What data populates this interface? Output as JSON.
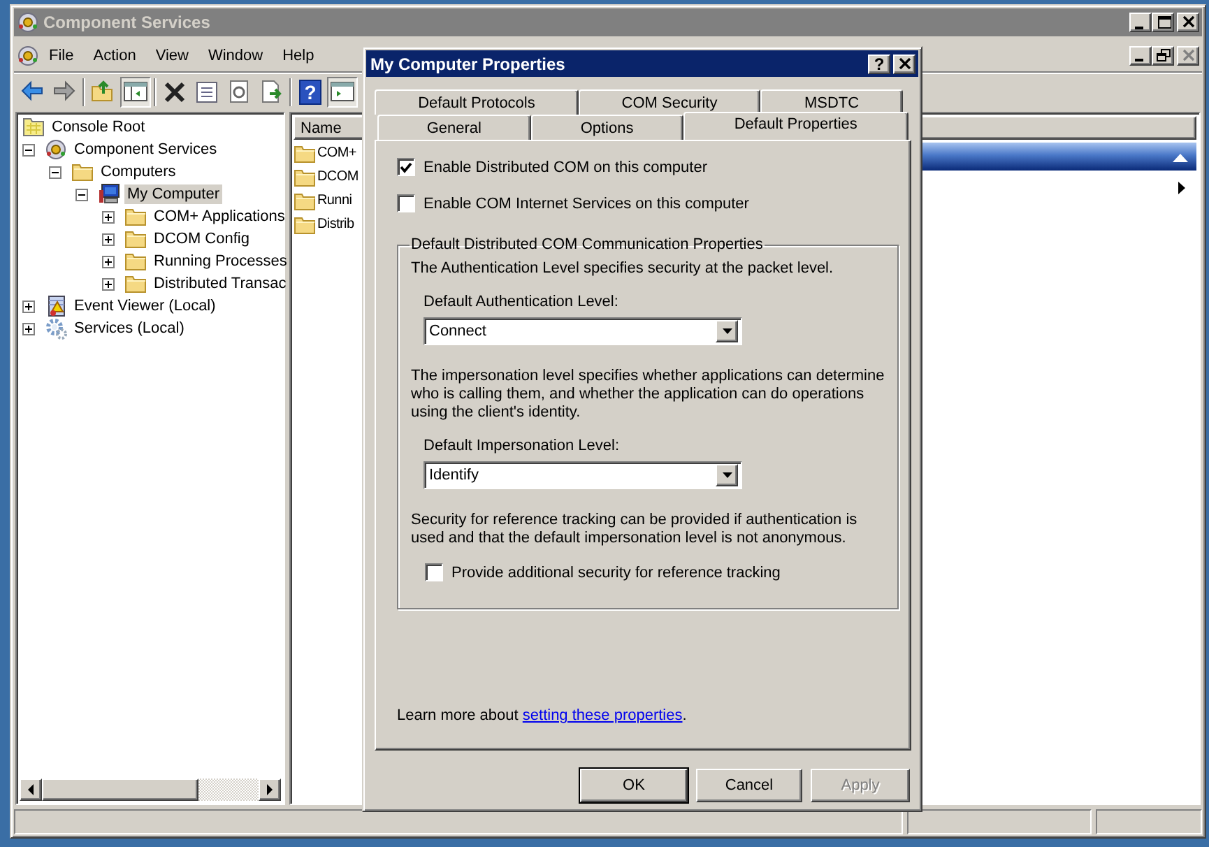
{
  "window": {
    "title": "Component Services"
  },
  "menu": [
    "File",
    "Action",
    "View",
    "Window",
    "Help"
  ],
  "toolbar": {
    "help_glyph": "?"
  },
  "tree": {
    "root": {
      "label": "Console Root",
      "kind": "root",
      "selected": false,
      "children": [
        {
          "label": "Component Services",
          "kind": "component",
          "expanded": true,
          "selected": false,
          "children": [
            {
              "label": "Computers",
              "kind": "folder",
              "expanded": true,
              "selected": false,
              "children": [
                {
                  "label": "My Computer",
                  "kind": "computer",
                  "expanded": true,
                  "selected": true,
                  "children": [
                    {
                      "label": "COM+ Applications",
                      "kind": "folder",
                      "expanded": false,
                      "selected": false
                    },
                    {
                      "label": "DCOM Config",
                      "kind": "folder",
                      "expanded": false,
                      "selected": false
                    },
                    {
                      "label": "Running Processes",
                      "kind": "folder",
                      "expanded": false,
                      "selected": false
                    },
                    {
                      "label": "Distributed Transac",
                      "kind": "folder",
                      "expanded": false,
                      "selected": false
                    }
                  ]
                }
              ]
            }
          ]
        },
        {
          "label": "Event Viewer (Local)",
          "kind": "log",
          "expanded": false,
          "selected": false
        },
        {
          "label": "Services (Local)",
          "kind": "gear",
          "expanded": false,
          "selected": false
        }
      ]
    }
  },
  "list": {
    "column": "Name",
    "items": [
      "COM+",
      "DCOM",
      "Runni",
      "Distrib"
    ]
  },
  "dialog": {
    "title": "My Computer Properties",
    "help_glyph": "?",
    "tab_rows": [
      [
        {
          "label": "Default Protocols",
          "selected": false
        },
        {
          "label": "COM Security",
          "selected": false
        },
        {
          "label": "MSDTC",
          "selected": false
        }
      ],
      [
        {
          "label": "General",
          "selected": false
        },
        {
          "label": "Options",
          "selected": false
        },
        {
          "label": "Default Properties",
          "selected": true
        }
      ]
    ],
    "options": [
      {
        "label": "Enable Distributed COM on this computer",
        "checked": true
      },
      {
        "label": "Enable COM Internet Services on this computer",
        "checked": false
      }
    ],
    "group": {
      "title": "Default Distributed COM Communication Properties",
      "items": [
        {
          "kind": "text",
          "text": "The Authentication Level specifies security at the packet level."
        },
        {
          "kind": "select",
          "label": "Default Authentication Level:",
          "value": "Connect"
        },
        {
          "kind": "text",
          "text": "The impersonation level specifies whether applications can determine who is calling them, and whether the application can do operations using the client's identity."
        },
        {
          "kind": "select",
          "label": "Default Impersonation Level:",
          "value": "Identify"
        },
        {
          "kind": "text",
          "text": "Security for reference tracking can be provided if authentication is used and that the default impersonation level is not anonymous."
        },
        {
          "kind": "checkbox",
          "label": "Provide additional security for reference tracking",
          "checked": false
        }
      ]
    },
    "learn_more": {
      "text": "Learn more about ",
      "link": "setting these properties",
      "end": "."
    },
    "buttons": [
      {
        "label": "OK",
        "default": true,
        "disabled": false
      },
      {
        "label": "Cancel",
        "default": false,
        "disabled": false
      },
      {
        "label": "Apply",
        "default": false,
        "disabled": true
      }
    ]
  }
}
